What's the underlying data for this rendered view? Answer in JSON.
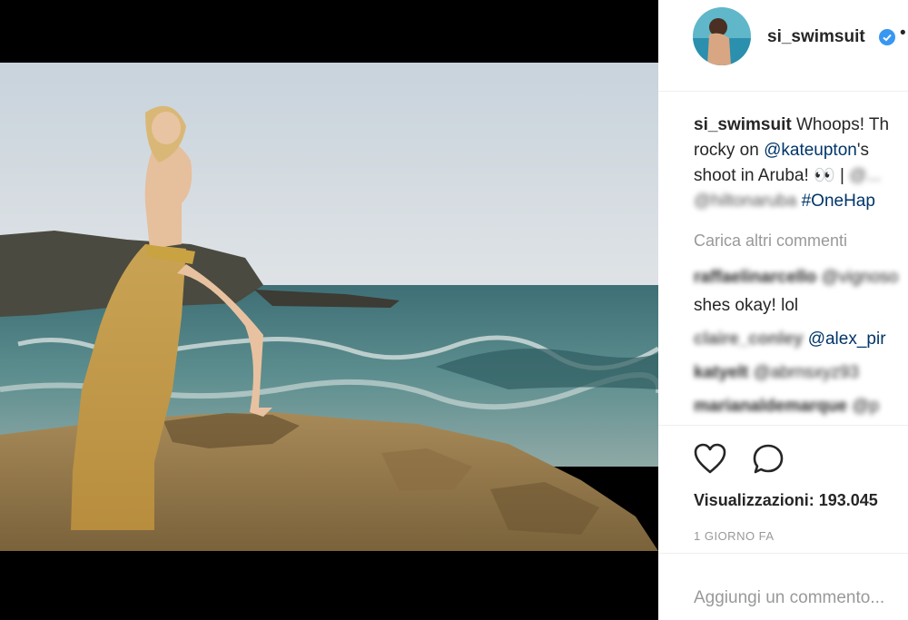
{
  "post": {
    "username": "si_swimsuit",
    "caption_user": "si_swimsuit",
    "caption_lines": [
      "Whoops! Th",
      "rocky on ",
      "@kateupton",
      "'s",
      "shoot in Aruba! 👀 |",
      "#OneHap"
    ],
    "caption_blur": [
      "@...",
      "@hiltonaruba"
    ]
  },
  "comments": {
    "load_more": "Carica altri commenti",
    "items": [
      {
        "user": "raffaelinarcello",
        "text": "@vignoso",
        "blurred": true
      },
      {
        "user": "",
        "text": "shes okay! lol",
        "blurred": false
      },
      {
        "user": "claire_conley",
        "mention": "@alex_pir",
        "blurred": true
      },
      {
        "user": "katyelt",
        "text": "@abrnsxyz93",
        "blurred": true
      },
      {
        "user": "marianaldemarque",
        "text": "@p",
        "blurred": true
      }
    ]
  },
  "stats": {
    "views_label": "Visualizzazioni: 193.045",
    "age": "1 GIORNO FA"
  },
  "add_comment": {
    "placeholder": "Aggiungi un commento..."
  },
  "colors": {
    "link": "#003569",
    "muted": "#999999",
    "verified": "#3897f0"
  },
  "icons": [
    "heart-icon",
    "comment-icon",
    "verified-badge-icon",
    "more-options-icon"
  ]
}
